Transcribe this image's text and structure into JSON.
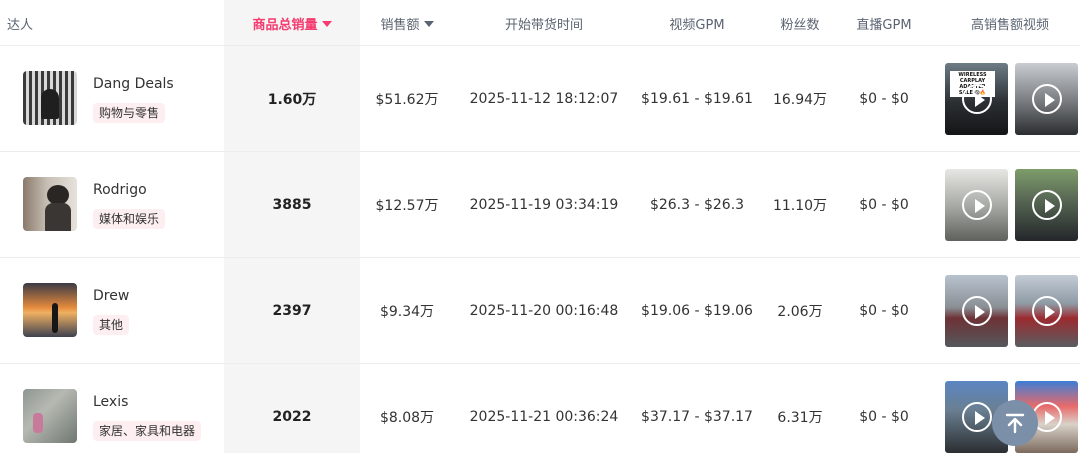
{
  "header": {
    "influencer": "达人",
    "total_sales": "商品总销量",
    "revenue": "销售额",
    "start_time": "开始带货时间",
    "video_gpm": "视频GPM",
    "followers": "粉丝数",
    "live_gpm": "直播GPM",
    "top_videos": "高销售额视频"
  },
  "accent_color": "#f53b6f",
  "rows": [
    {
      "name": "Dang Deals",
      "category": "购物与零售",
      "total_sales": "1.60万",
      "revenue": "$51.62万",
      "start_time": "2025-11-12 18:12:07",
      "video_gpm": "$19.61 - $19.61",
      "followers": "16.94万",
      "live_gpm": "$0 - $0",
      "thumb_caption": "WIRELESS CARPLAY ADAPTER SALE 😱🔥"
    },
    {
      "name": "Rodrigo",
      "category": "媒体和娱乐",
      "total_sales": "3885",
      "revenue": "$12.57万",
      "start_time": "2025-11-19 03:34:19",
      "video_gpm": "$26.3 - $26.3",
      "followers": "11.10万",
      "live_gpm": "$0 - $0"
    },
    {
      "name": "Drew",
      "category": "其他",
      "total_sales": "2397",
      "revenue": "$9.34万",
      "start_time": "2025-11-20 00:16:48",
      "video_gpm": "$19.06 - $19.06",
      "followers": "2.06万",
      "live_gpm": "$0 - $0"
    },
    {
      "name": "Lexis",
      "category": "家居、家具和电器",
      "total_sales": "2022",
      "revenue": "$8.08万",
      "start_time": "2025-11-21 00:36:24",
      "video_gpm": "$37.17 - $37.17",
      "followers": "6.31万",
      "live_gpm": "$0 - $0"
    }
  ],
  "icons": {
    "sort": "caret-down-icon",
    "play": "play-icon",
    "back_to_top": "arrow-up-icon"
  }
}
